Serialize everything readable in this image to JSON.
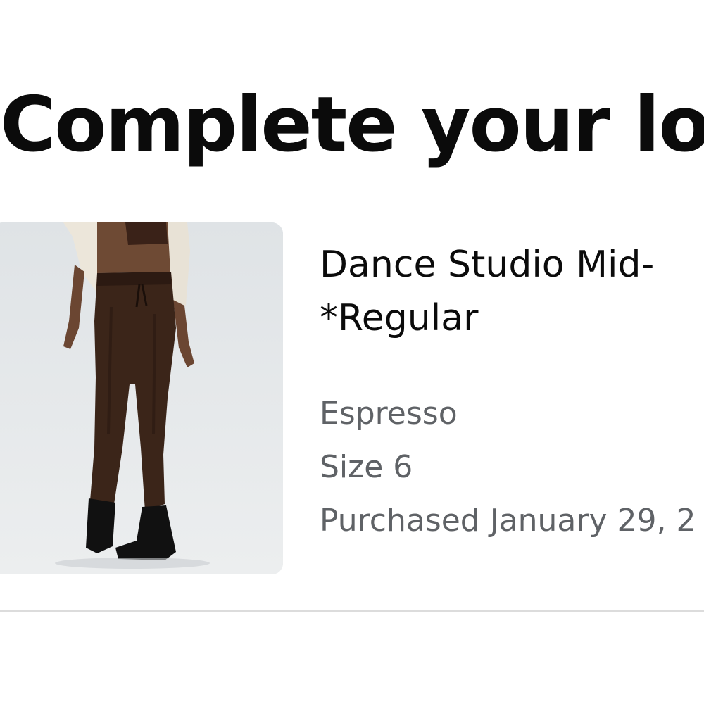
{
  "page": {
    "title": "Complete your loo"
  },
  "product": {
    "name_line1": "Dance Studio Mid-",
    "name_line2": "*Regular",
    "color": "Espresso",
    "size": "Size 6",
    "purchased": "Purchased January 29, 2",
    "image_label": "product-photo"
  },
  "colors": {
    "title": "#0b0b0b",
    "meta": "#5f6266",
    "image_bg": "#e6e8ea",
    "divider": "#dcdcdc"
  }
}
